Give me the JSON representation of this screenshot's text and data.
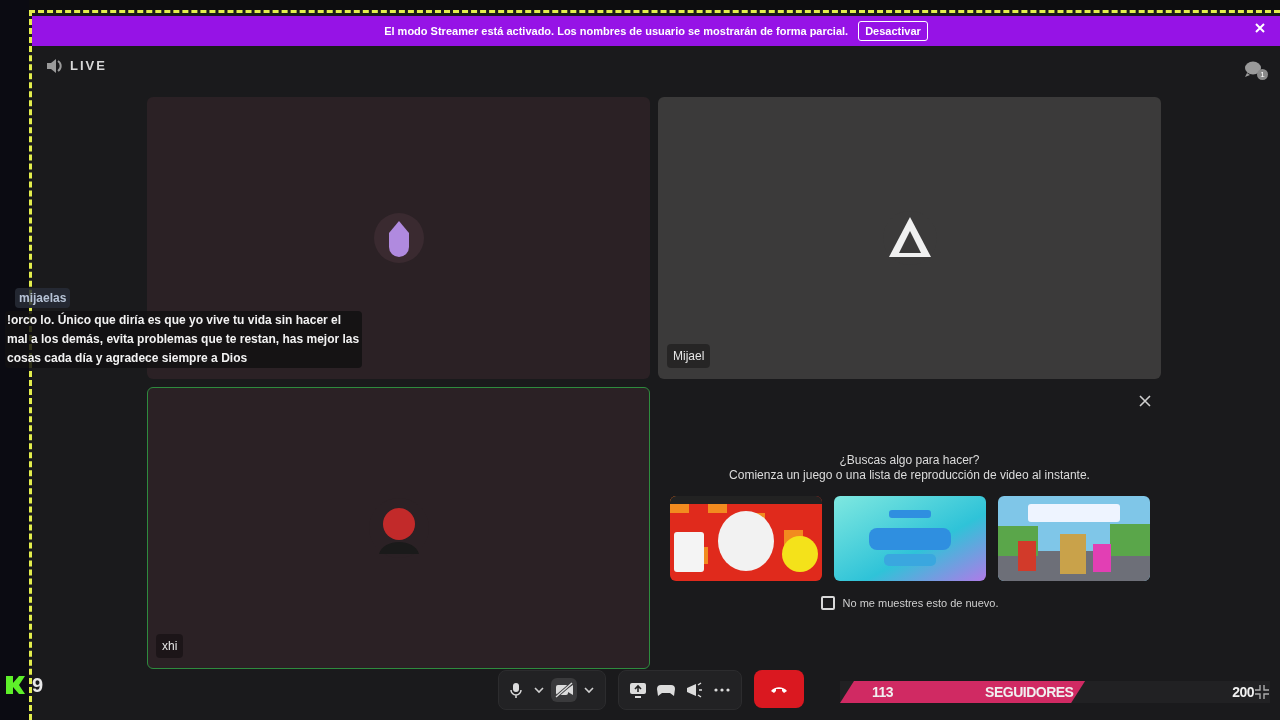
{
  "banner": {
    "text": "El modo Streamer está activado. Los nombres de usuario se mostrarán de forma parcial.",
    "button": "Desactivar"
  },
  "header": {
    "title": "LIVE",
    "chat_badge": "1"
  },
  "tiles": [
    {
      "kind": "unnamed",
      "speaking": false,
      "color": "#2b2125"
    },
    {
      "kind": "named",
      "name": "Mijael",
      "speaking": false,
      "color": "#3b3a3a"
    },
    {
      "kind": "named",
      "name": "xhi",
      "speaking": true,
      "color": "#2b2125"
    }
  ],
  "activity_panel": {
    "heading": "¿Buscas algo para hacer?",
    "subheading": "Comienza un juego o una lista de reproducción de video al instante.",
    "checkbox": {
      "label": "No me muestres esto de nuevo.",
      "checked": false
    }
  },
  "controls": {
    "mic_on": true,
    "camera_on": false
  },
  "chat_overlay": {
    "username": "mijaelas",
    "message": "!orco lo. Único que diría es que yo vive tu vida sin hacer el mal a los demás, evita problemas que te restan, has mejor las cosas cada día y agradece siempre a Dios"
  },
  "follower_goal": {
    "current": "113",
    "label": "SEGUIDORES",
    "goal": "200",
    "level": 0.57
  },
  "corner_counter": {
    "value": "9"
  }
}
